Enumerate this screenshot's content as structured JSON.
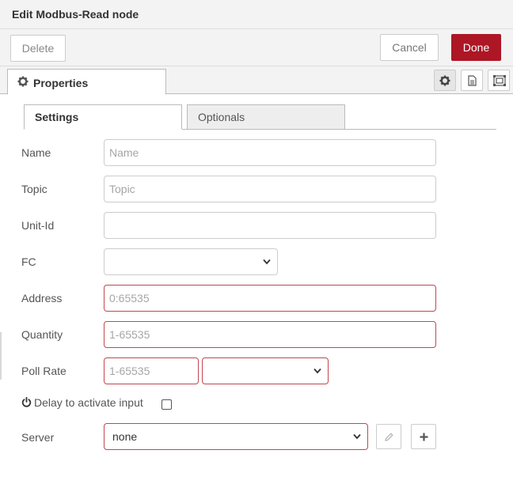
{
  "tray": {
    "title": "Edit Modbus-Read node"
  },
  "toolbar": {
    "delete_label": "Delete",
    "cancel_label": "Cancel",
    "done_label": "Done"
  },
  "tabs": {
    "properties_label": "Properties"
  },
  "subtabs": {
    "settings_label": "Settings",
    "optionals_label": "Optionals"
  },
  "form": {
    "name": {
      "label": "Name",
      "placeholder": "Name",
      "value": ""
    },
    "topic": {
      "label": "Topic",
      "placeholder": "Topic",
      "value": ""
    },
    "unit_id": {
      "label": "Unit-Id",
      "value": ""
    },
    "fc": {
      "label": "FC",
      "value": ""
    },
    "address": {
      "label": "Address",
      "placeholder": "0:65535"
    },
    "quantity": {
      "label": "Quantity",
      "placeholder": "1-65535"
    },
    "poll_rate": {
      "label": "Poll Rate",
      "placeholder": "1-65535",
      "unit_value": ""
    },
    "delay": {
      "label": "Delay to activate input",
      "checked": false
    },
    "server": {
      "label": "Server",
      "value": "none"
    }
  },
  "colors": {
    "done_bg": "#ad1625",
    "error_border": "#c24651"
  },
  "icons": [
    "gear-icon",
    "info-icon",
    "appearance-icon",
    "power-icon",
    "pencil-icon",
    "plus-icon",
    "chevron-down-icon"
  ]
}
